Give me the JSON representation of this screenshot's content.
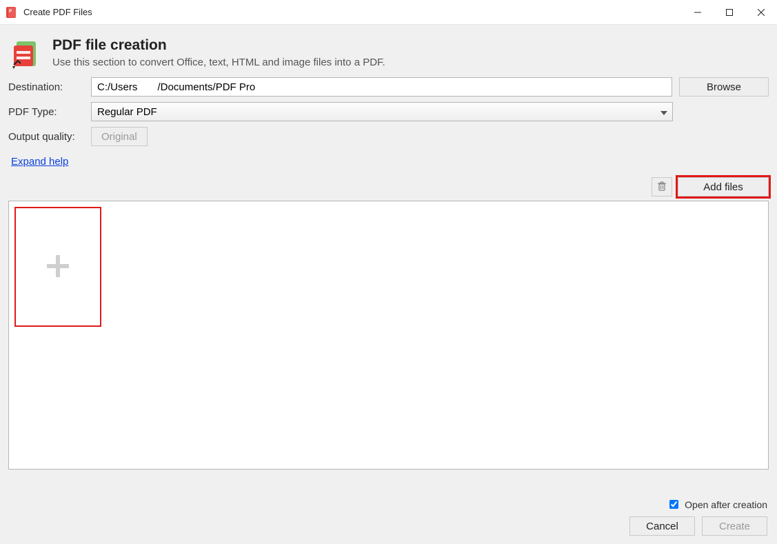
{
  "window": {
    "title": "Create PDF Files"
  },
  "header": {
    "title": "PDF file creation",
    "subtitle": "Use this section to convert Office, text, HTML and image files into a PDF."
  },
  "form": {
    "destination_label": "Destination:",
    "destination_value": "C:/Users       /Documents/PDF Pro",
    "browse_label": "Browse",
    "pdf_type_label": "PDF Type:",
    "pdf_type_value": "Regular PDF",
    "output_quality_label": "Output quality:",
    "output_quality_value": "Original"
  },
  "links": {
    "expand_help": "Expand help"
  },
  "toolbar": {
    "add_files_label": "Add files"
  },
  "footer": {
    "open_after_label": "Open after creation",
    "open_after_checked": true,
    "cancel_label": "Cancel",
    "create_label": "Create"
  }
}
